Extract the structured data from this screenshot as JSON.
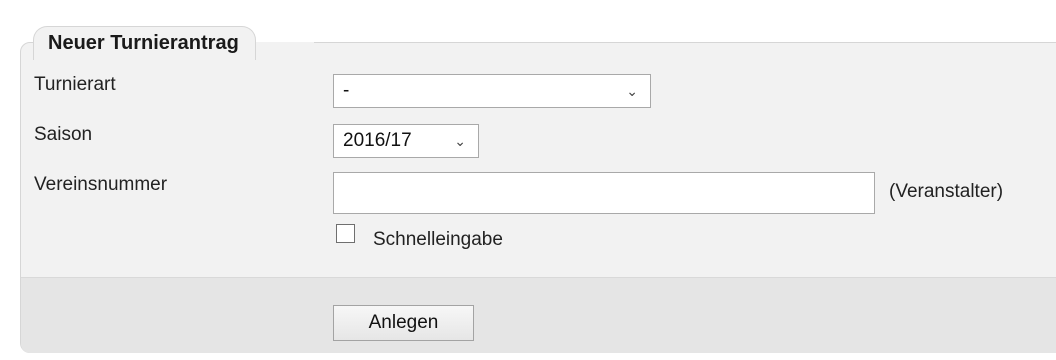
{
  "form": {
    "legend": "Neuer Turnierantrag",
    "fields": {
      "turnierart": {
        "label": "Turnierart",
        "selected": "-"
      },
      "saison": {
        "label": "Saison",
        "selected": "2016/17"
      },
      "vereinsnummer": {
        "label": "Vereinsnummer",
        "value": "",
        "hint": "(Veranstalter)"
      },
      "schnelleingabe": {
        "label": "Schnelleingabe",
        "checked": false
      }
    },
    "submit_label": "Anlegen"
  },
  "icons": {
    "dropdown": "chevron-down-icon",
    "checkbox": "checkbox-unchecked"
  },
  "colors": {
    "panel_bg": "#f2f2f2",
    "footer_bg": "#e5e5e5",
    "border": "#d6d6d6",
    "input_border": "#a9a9a9"
  }
}
